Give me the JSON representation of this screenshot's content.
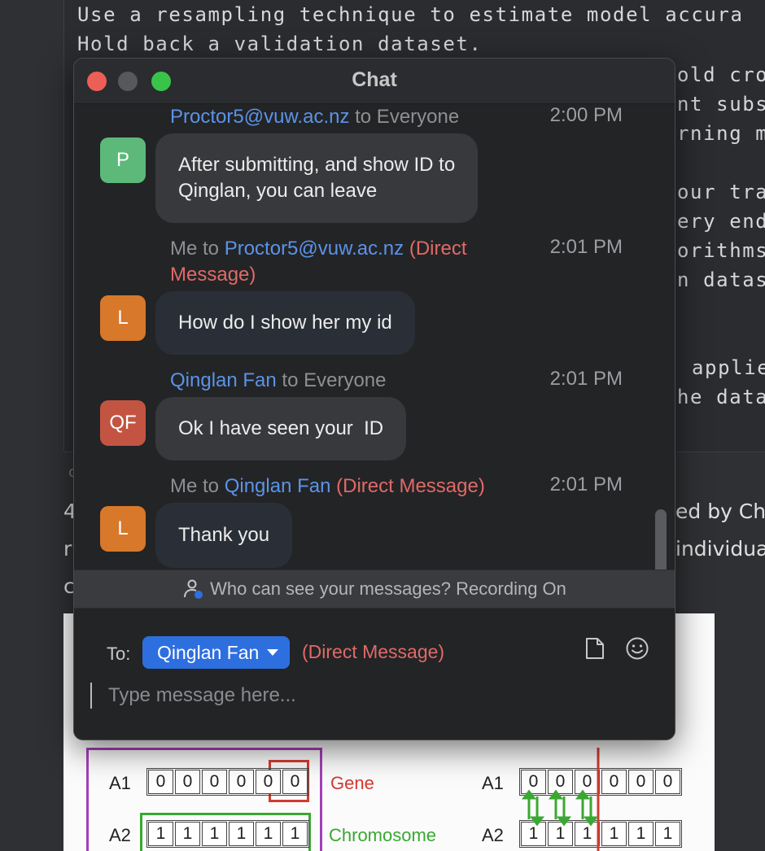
{
  "background": {
    "code_lines": [
      "Use a resampling technique to estimate model accura",
      "Hold back a validation dataset."
    ],
    "code_fragments": [
      "old cro",
      "nt subs",
      "rning m",
      "our tra",
      "ery end",
      "orithms",
      "n datas",
      "applie",
      "he data"
    ],
    "prose_lines": [
      "ed by Ch",
      "individua"
    ],
    "prose_left": [
      "4",
      "r",
      "c"
    ],
    "tiny_marker": "c",
    "ga": {
      "rows": [
        {
          "label": "A1",
          "cells": [
            "0",
            "0",
            "0",
            "0",
            "0",
            "0"
          ]
        },
        {
          "label": "A2",
          "cells": [
            "1",
            "1",
            "1",
            "1",
            "1",
            "1"
          ]
        }
      ],
      "gene_label": "Gene",
      "chromosome_label": "Chromosome",
      "right_rows": [
        {
          "label": "A1",
          "cells": [
            "0",
            "0",
            "0",
            "0",
            "0",
            "0"
          ]
        },
        {
          "label": "A2",
          "cells": [
            "1",
            "1",
            "1",
            "1",
            "1",
            "1"
          ]
        }
      ],
      "colors": {
        "gene": "#d23b30",
        "chromosome": "#3aa832",
        "outer": "#a43fb8",
        "crossover": "#d23b30"
      }
    }
  },
  "chat": {
    "title": "Chat",
    "messages": [
      {
        "sender": "Proctor5@vuw.ac.nz",
        "to": "to Everyone",
        "dm": "",
        "time": "2:00 PM",
        "avatar": "P",
        "avatar_color": "#5cb97a",
        "text_lines": [
          "After submitting, and show ID to",
          "Qinglan, you can leave"
        ]
      },
      {
        "prefix": "Me to ",
        "sender": "Proctor5@vuw.ac.nz",
        "dm": "(Direct Message)",
        "time": "2:01 PM",
        "avatar": "L",
        "avatar_color": "#d7782b",
        "text": "How do I show her my id"
      },
      {
        "sender": "Qinglan Fan",
        "to": "to Everyone",
        "dm": "",
        "time": "2:01 PM",
        "avatar": "QF",
        "avatar_color": "#c45442",
        "text": "Ok I have seen your  ID"
      },
      {
        "prefix": "Me to ",
        "sender": "Qinglan Fan",
        "dm": "(Direct Message)",
        "time": "2:01 PM",
        "avatar": "L",
        "avatar_color": "#d7782b",
        "text": "Thank you"
      }
    ],
    "notice": "Who can see your messages? Recording On",
    "composer": {
      "to_label": "To:",
      "recipient": "Qinglan Fan",
      "dm_label": "(Direct Message)",
      "placeholder": "Type message here...",
      "file_icon": "file-icon",
      "emoji_icon": "emoji-icon"
    }
  }
}
